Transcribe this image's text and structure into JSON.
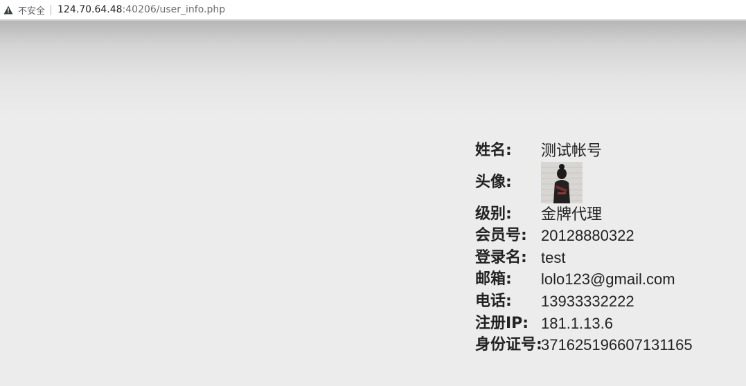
{
  "browser": {
    "security_label": "不安全",
    "url_host": "124.70.64.48",
    "url_path": ":40206/user_info.php"
  },
  "profile": {
    "rows": [
      {
        "label": "姓名:",
        "value": "测试帐号"
      },
      {
        "label": "头像:",
        "value": ""
      },
      {
        "label": "级别:",
        "value": "金牌代理"
      },
      {
        "label": "会员号:",
        "value": "20128880322"
      },
      {
        "label": "登录名:",
        "value": "test"
      },
      {
        "label": "邮箱:",
        "value": "lolo123@gmail.com"
      },
      {
        "label": "电话:",
        "value": "13933332222"
      },
      {
        "label": "注册IP:",
        "value": "181.1.13.6"
      },
      {
        "label": "身份证号:",
        "value": "371625196607131165"
      }
    ]
  }
}
